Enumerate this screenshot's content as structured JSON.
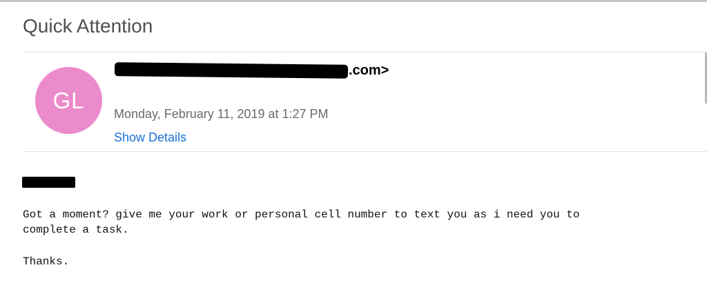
{
  "email": {
    "subject": "Quick Attention",
    "avatar_initials": "GL",
    "sender_visible_suffix": ".com>",
    "date": "Monday, February 11, 2019 at 1:27 PM",
    "show_details_label": "Show Details",
    "body_lines": [
      "Got a moment? give me your work or personal cell number to text you as i need you to",
      "complete a task.",
      "Thanks."
    ]
  },
  "colors": {
    "avatar_bg": "#eb8bcb",
    "link": "#1a73d9",
    "subject": "#4f4f4f",
    "date": "#6a6a6a"
  }
}
